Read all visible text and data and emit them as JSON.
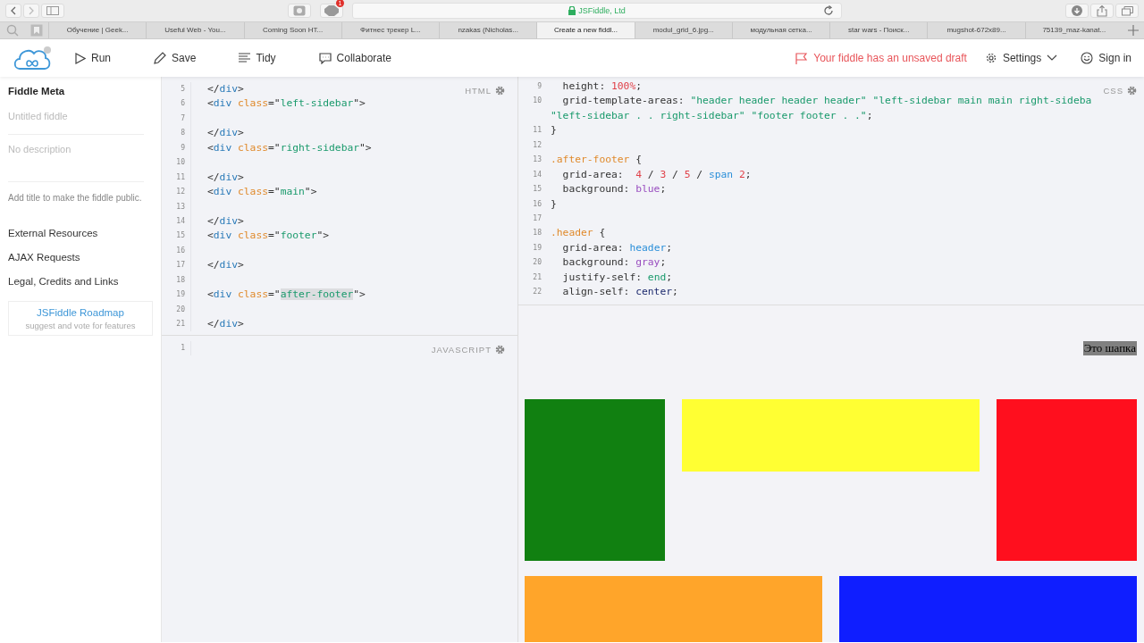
{
  "browser": {
    "address": "JSFiddle, Ltd",
    "badge": "1",
    "tabs": [
      {
        "label": "Обучение | Geek...",
        "selected": false
      },
      {
        "label": "Useful Web - You...",
        "selected": false
      },
      {
        "label": "Coming Soon HT...",
        "selected": false
      },
      {
        "label": "Фитнес трекер L...",
        "selected": false
      },
      {
        "label": "nzakas (Nicholas...",
        "selected": false
      },
      {
        "label": "Create a new fiddl...",
        "selected": true
      },
      {
        "label": "modul_grid_6.jpg...",
        "selected": false
      },
      {
        "label": "модульная сетка...",
        "selected": false
      },
      {
        "label": "star wars - Поиск...",
        "selected": false
      },
      {
        "label": "mugshot-672x89...",
        "selected": false
      },
      {
        "label": "75139_maz-kanat...",
        "selected": false
      }
    ]
  },
  "toolbar": {
    "actions": [
      {
        "kind": "run",
        "label": "Run"
      },
      {
        "kind": "save",
        "label": "Save"
      },
      {
        "kind": "tidy",
        "label": "Tidy"
      },
      {
        "kind": "collaborate",
        "label": "Collaborate"
      }
    ],
    "draft_notice": "Your fiddle has an unsaved draft",
    "settings": "Settings",
    "sign_in": "Sign in"
  },
  "sidebar": {
    "title": "Fiddle Meta",
    "title_placeholder": "Untitled fiddle",
    "description_placeholder": "No description",
    "hint": "Add title to make the fiddle public.",
    "links": [
      "External Resources",
      "AJAX Requests",
      "Legal, Credits and Links"
    ],
    "roadmap": {
      "title": "JSFiddle Roadmap",
      "subtitle": "suggest and vote for features"
    }
  },
  "html_editor": {
    "label": "HTML",
    "lines": [
      {
        "number": "5",
        "tokens": [
          {
            "kind": "punct",
            "text": "</"
          },
          {
            "kind": "tag",
            "text": "div"
          },
          {
            "kind": "punct",
            "text": ">"
          }
        ]
      },
      {
        "number": "6",
        "tokens": [
          {
            "kind": "punct",
            "text": "<"
          },
          {
            "kind": "tag",
            "text": "div"
          },
          {
            "kind": "attr",
            "text": " class"
          },
          {
            "kind": "punct",
            "text": "=\""
          },
          {
            "kind": "string",
            "text": "left-sidebar"
          },
          {
            "kind": "punct",
            "text": "\">"
          }
        ]
      },
      {
        "number": "7"
      },
      {
        "number": "8",
        "tokens": [
          {
            "kind": "punct",
            "text": "</"
          },
          {
            "kind": "tag",
            "text": "div"
          },
          {
            "kind": "punct",
            "text": ">"
          }
        ]
      },
      {
        "number": "9",
        "tokens": [
          {
            "kind": "punct",
            "text": "<"
          },
          {
            "kind": "tag",
            "text": "div"
          },
          {
            "kind": "attr",
            "text": " class"
          },
          {
            "kind": "punct",
            "text": "=\""
          },
          {
            "kind": "string",
            "text": "right-sidebar"
          },
          {
            "kind": "punct",
            "text": "\">"
          }
        ]
      },
      {
        "number": "10"
      },
      {
        "number": "11",
        "tokens": [
          {
            "kind": "punct",
            "text": "</"
          },
          {
            "kind": "tag",
            "text": "div"
          },
          {
            "kind": "punct",
            "text": ">"
          }
        ]
      },
      {
        "number": "12",
        "tokens": [
          {
            "kind": "punct",
            "text": "<"
          },
          {
            "kind": "tag",
            "text": "div"
          },
          {
            "kind": "attr",
            "text": " class"
          },
          {
            "kind": "punct",
            "text": "=\""
          },
          {
            "kind": "string",
            "text": "main"
          },
          {
            "kind": "punct",
            "text": "\">"
          }
        ]
      },
      {
        "number": "13"
      },
      {
        "number": "14",
        "tokens": [
          {
            "kind": "punct",
            "text": "</"
          },
          {
            "kind": "tag",
            "text": "div"
          },
          {
            "kind": "punct",
            "text": ">"
          }
        ]
      },
      {
        "number": "15",
        "tokens": [
          {
            "kind": "punct",
            "text": "<"
          },
          {
            "kind": "tag",
            "text": "div"
          },
          {
            "kind": "attr",
            "text": " class"
          },
          {
            "kind": "punct",
            "text": "=\""
          },
          {
            "kind": "string",
            "text": "footer"
          },
          {
            "kind": "punct",
            "text": "\">"
          }
        ]
      },
      {
        "number": "16"
      },
      {
        "number": "17",
        "tokens": [
          {
            "kind": "punct",
            "text": "</"
          },
          {
            "kind": "tag",
            "text": "div"
          },
          {
            "kind": "punct",
            "text": ">"
          }
        ]
      },
      {
        "number": "18"
      },
      {
        "number": "19",
        "tokens": [
          {
            "kind": "punct",
            "text": "<"
          },
          {
            "kind": "tag",
            "text": "div"
          },
          {
            "kind": "attr",
            "text": " class"
          },
          {
            "kind": "punct",
            "text": "=\""
          },
          {
            "kind": "string",
            "text": "after-footer",
            "highlighted": true
          },
          {
            "kind": "punct",
            "text": "\">"
          }
        ]
      },
      {
        "number": "20"
      },
      {
        "number": "21",
        "tokens": [
          {
            "kind": "punct",
            "text": "</"
          },
          {
            "kind": "tag",
            "text": "div"
          },
          {
            "kind": "punct",
            "text": ">"
          }
        ]
      }
    ]
  },
  "js_editor": {
    "label": "JAVASCRIPT",
    "lines": [
      {
        "number": "1"
      }
    ]
  },
  "css_editor": {
    "label": "CSS",
    "lines": [
      {
        "number": "9",
        "tokens": [
          {
            "kind": "punct",
            "text": "  height: "
          },
          {
            "kind": "number",
            "text": "100%"
          },
          {
            "kind": "punct",
            "text": ";"
          }
        ]
      },
      {
        "number": "10",
        "tokens": [
          {
            "kind": "punct",
            "text": "  grid-template-areas: "
          },
          {
            "kind": "value",
            "text": "\"header header header header\" \"left-sidebar main main right-sideba"
          }
        ]
      },
      {
        "tokens": [
          {
            "kind": "value",
            "text": "\"left-sidebar . . right-sidebar\" \"footer footer . .\""
          },
          {
            "kind": "punct",
            "text": ";"
          }
        ]
      },
      {
        "number": "11",
        "tokens": [
          {
            "kind": "punct",
            "text": "}"
          }
        ]
      },
      {
        "number": "12"
      },
      {
        "number": "13",
        "tokens": [
          {
            "kind": "selector",
            "text": ".after-footer"
          },
          {
            "kind": "punct",
            "text": " {"
          }
        ]
      },
      {
        "number": "14",
        "tokens": [
          {
            "kind": "punct",
            "text": "  grid-area:  "
          },
          {
            "kind": "number",
            "text": "4"
          },
          {
            "kind": "punct",
            "text": " / "
          },
          {
            "kind": "number",
            "text": "3"
          },
          {
            "kind": "punct",
            "text": " / "
          },
          {
            "kind": "number",
            "text": "5"
          },
          {
            "kind": "punct",
            "text": " / "
          },
          {
            "kind": "keyword",
            "text": "span"
          },
          {
            "kind": "number",
            "text": " 2"
          },
          {
            "kind": "punct",
            "text": ";"
          }
        ]
      },
      {
        "number": "15",
        "tokens": [
          {
            "kind": "punct",
            "text": "  background: "
          },
          {
            "kind": "atom",
            "text": "blue"
          },
          {
            "kind": "punct",
            "text": ";"
          }
        ]
      },
      {
        "number": "16",
        "tokens": [
          {
            "kind": "punct",
            "text": "}"
          }
        ]
      },
      {
        "number": "17"
      },
      {
        "number": "18",
        "tokens": [
          {
            "kind": "selector",
            "text": ".header"
          },
          {
            "kind": "punct",
            "text": " {"
          }
        ]
      },
      {
        "number": "19",
        "tokens": [
          {
            "kind": "punct",
            "text": "  grid-area: "
          },
          {
            "kind": "keyword",
            "text": "header"
          },
          {
            "kind": "punct",
            "text": ";"
          }
        ]
      },
      {
        "number": "20",
        "tokens": [
          {
            "kind": "punct",
            "text": "  background: "
          },
          {
            "kind": "atom",
            "text": "gray"
          },
          {
            "kind": "punct",
            "text": ";"
          }
        ]
      },
      {
        "number": "21",
        "tokens": [
          {
            "kind": "punct",
            "text": "  justify-self: "
          },
          {
            "kind": "value",
            "text": "end"
          },
          {
            "kind": "punct",
            "text": ";"
          }
        ]
      },
      {
        "number": "22",
        "tokens": [
          {
            "kind": "punct",
            "text": "  align-self: "
          },
          {
            "kind": "navy",
            "text": "center"
          },
          {
            "kind": "punct",
            "text": ";"
          }
        ]
      }
    ]
  },
  "result": {
    "header_text": "Это шапка",
    "blocks": [
      {
        "kind": "left-sidebar",
        "color": "#118011"
      },
      {
        "kind": "main",
        "color": "#ffff33"
      },
      {
        "kind": "right-sidebar",
        "color": "#ff0f1e"
      },
      {
        "kind": "footer",
        "color": "#ffa52a"
      },
      {
        "kind": "after-footer",
        "color": "#0f1eff"
      }
    ]
  }
}
